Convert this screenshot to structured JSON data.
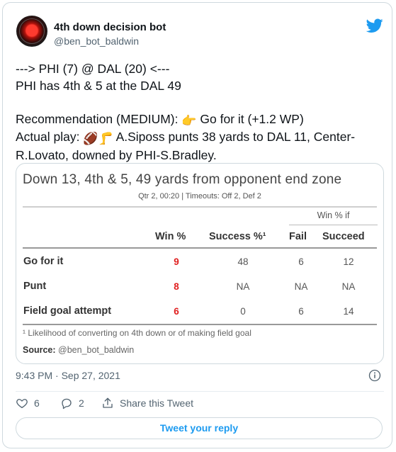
{
  "author": {
    "name": "4th down decision bot",
    "handle": "@ben_bot_baldwin"
  },
  "tweet": {
    "line1": "---> PHI (7) @ DAL (20) <---",
    "line2": "PHI has 4th & 5 at the DAL 49",
    "line3_prefix": "Recommendation (MEDIUM): ",
    "line3_suffix": " Go for it (+1.2 WP)",
    "line4_prefix": "Actual play: ",
    "line4_suffix": " A.Siposs punts 38 yards to DAL 11, Center-",
    "line5": "R.Lovato, downed by PHI-S.Bradley.",
    "emoji_hand": "👉",
    "emoji_football": "🏈",
    "emoji_leg": "🦵"
  },
  "table": {
    "title": "Down 13, 4th & 5, 49 yards from opponent end zone",
    "subtitle": "Qtr 2, 00:20 | Timeouts: Off 2, Def 2",
    "win_if_label": "Win % if",
    "headers": {
      "win": "Win %",
      "success": "Success %¹",
      "fail": "Fail",
      "succeed": "Succeed"
    },
    "rows": [
      {
        "label": "Go for it",
        "win": "9",
        "success": "48",
        "fail": "6",
        "succeed": "12"
      },
      {
        "label": "Punt",
        "win": "8",
        "success": "NA",
        "fail": "NA",
        "succeed": "NA"
      },
      {
        "label": "Field goal attempt",
        "win": "6",
        "success": "0",
        "fail": "6",
        "succeed": "14"
      }
    ],
    "footnote": "¹ Likelihood of converting on 4th down or of making field goal",
    "source_label": "Source:",
    "source_value": " @ben_bot_baldwin"
  },
  "meta": {
    "timestamp": "9:43 PM · Sep 27, 2021"
  },
  "actions": {
    "likes": "6",
    "replies": "2",
    "share_label": "Share this Tweet"
  },
  "reply_button": "Tweet your reply",
  "colors": {
    "accent": "#1d9bf0",
    "win_red": "#e02020"
  }
}
